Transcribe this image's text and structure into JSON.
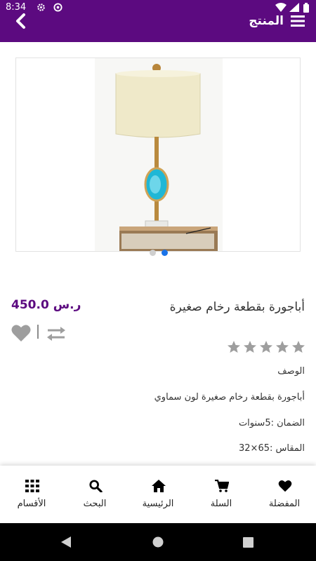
{
  "status_bar": {
    "time": "8:34"
  },
  "app_bar": {
    "title": "المنتج"
  },
  "product": {
    "name": "أباجورة بقطعة رخام صغيرة",
    "price": "450.0 ر.س",
    "rating": 0,
    "rating_max": 5,
    "carousel": {
      "count": 2,
      "active_index": 1
    }
  },
  "details": {
    "description_label": "الوصف",
    "description": "أباجورة بقطعة رخام صغيرة لون سماوي",
    "warranty": "الضمان :5سنوات",
    "size": "المقاس :65×32"
  },
  "bottom_nav": {
    "favorites": "المفضلة",
    "cart": "السلة",
    "home": "الرئيسية",
    "search": "البحث",
    "categories": "الأقسام"
  },
  "colors": {
    "primary": "#5c0a80",
    "accent": "#1a73e8",
    "star_inactive": "#9e9e9e"
  }
}
